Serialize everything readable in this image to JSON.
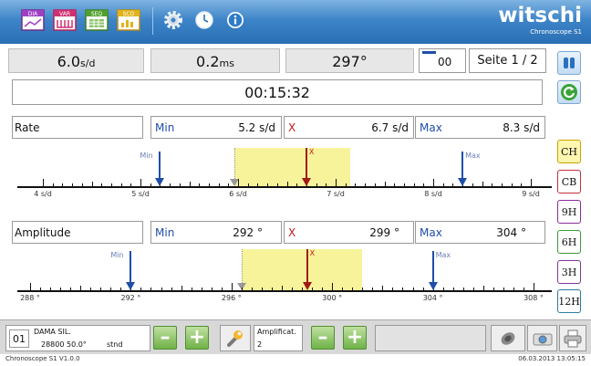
{
  "toolbar": {
    "buttons": [
      {
        "name": "dia-icon",
        "label": "DIA"
      },
      {
        "name": "var-icon",
        "label": "VAR"
      },
      {
        "name": "seq-icon",
        "label": "SEQ"
      },
      {
        "name": "sco-icon",
        "label": "SCO"
      }
    ],
    "logo": "witschi",
    "logo_sub": "Chronoscope S1"
  },
  "stats": {
    "rate_value": "6.0",
    "rate_unit": "s/d",
    "beat_value": "0.2",
    "beat_unit": "ms",
    "amplitude_value": "297°",
    "counter": "00",
    "page": "Seite 1 / 2",
    "timer": "00:15:32"
  },
  "rate_row": {
    "label": "Rate",
    "min_label": "Min",
    "min_value": "5.2 s/d",
    "x_label": "X",
    "x_value": "6.7 s/d",
    "max_label": "Max",
    "max_value": "8.3 s/d"
  },
  "rate_scale": {
    "ticks": [
      "4 s/d",
      "5 s/d",
      "6 s/d",
      "7 s/d",
      "8 s/d",
      "9 s/d"
    ],
    "range": [
      4,
      9
    ],
    "min": 5.2,
    "mean": 6.7,
    "max": 8.3,
    "marker_min": "Min",
    "marker_x": "X",
    "marker_max": "Max"
  },
  "amplitude_row": {
    "label": "Amplitude",
    "min_label": "Min",
    "min_value": "292 °",
    "x_label": "X",
    "x_value": "299 °",
    "max_label": "Max",
    "max_value": "304 °"
  },
  "amplitude_scale": {
    "ticks": [
      "288 °",
      "292 °",
      "296 °",
      "300 °",
      "304 °",
      "308 °"
    ],
    "range": [
      288,
      308
    ],
    "min": 292,
    "mean": 299,
    "max": 304,
    "marker_min": "Min",
    "marker_x": "X",
    "marker_max": "Max"
  },
  "side_buttons": [
    "CH",
    "CB",
    "9H",
    "6H",
    "3H",
    "12H"
  ],
  "bottom": {
    "index": "01",
    "watch_name": "DAMA SIL.",
    "watch_params": "28800 50.0°",
    "position": "stnd",
    "amplif_label": "Amplificat.",
    "amplif_value": "2"
  },
  "footer": {
    "version": "Chronoscope S1 V1.0.0",
    "datetime": "06.03.2013 13:05:15"
  },
  "colors": {
    "toolbar_blue": "#2a6fb3",
    "band_yellow": "#f7f39a",
    "marker_blue": "#1f4ea8",
    "marker_red": "#a01818"
  }
}
